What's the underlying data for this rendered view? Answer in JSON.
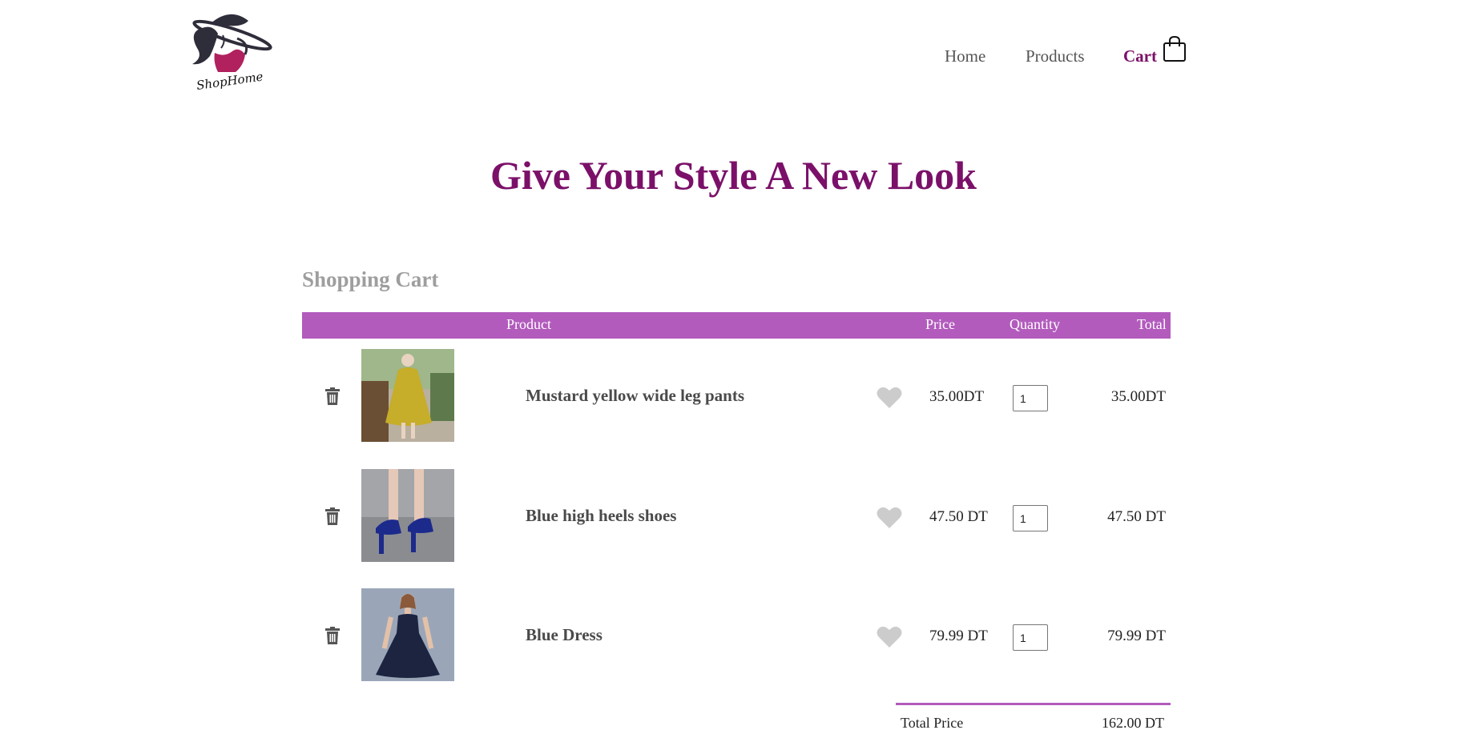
{
  "brand": {
    "logo_text": "ShopHome"
  },
  "nav": {
    "home": "Home",
    "products": "Products",
    "cart": "Cart",
    "cart_icon": "shopping-bag-icon"
  },
  "hero": {
    "title": "Give Your Style A New Look"
  },
  "cart": {
    "title": "Shopping Cart",
    "headers": {
      "product": "Product",
      "price": "Price",
      "quantity": "Quantity",
      "total": "Total"
    },
    "items": [
      {
        "name": "Mustard yellow wide leg pants",
        "price": "35.00DT",
        "quantity": "1",
        "total": "35.00DT",
        "image": "mustard-outfit-photo"
      },
      {
        "name": "Blue high heels shoes",
        "price": "47.50 DT",
        "quantity": "1",
        "total": "47.50 DT",
        "image": "blue-heels-photo"
      },
      {
        "name": "Blue Dress",
        "price": "79.99 DT",
        "quantity": "1",
        "total": "79.99 DT",
        "image": "blue-dress-photo"
      }
    ],
    "summary": {
      "label": "Total Price",
      "value": "162.00 DT"
    }
  },
  "colors": {
    "accent": "#7b1069",
    "table_header": "#b25bbd",
    "muted_heading": "#9e9e9e",
    "heart": "#cccccc"
  }
}
